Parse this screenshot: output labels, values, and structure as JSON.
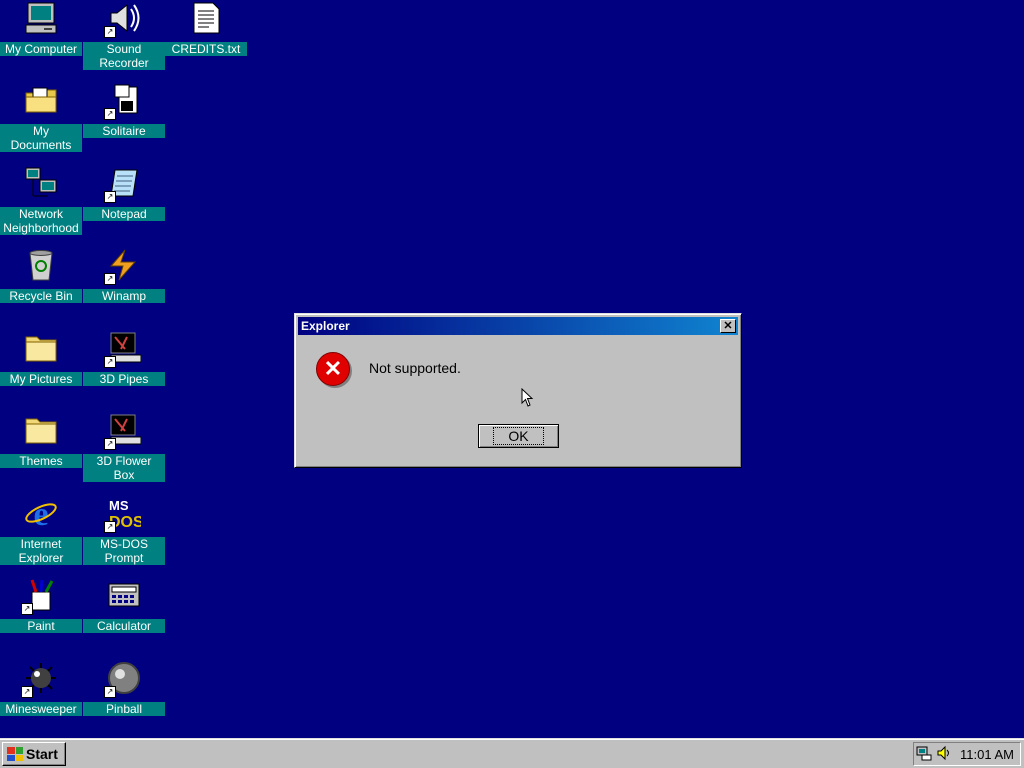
{
  "desktop": {
    "icons": [
      {
        "label": "My Computer",
        "icon": "computer-icon"
      },
      {
        "label": "Sound\nRecorder",
        "icon": "sound-recorder-icon"
      },
      {
        "label": "CREDITS.txt",
        "icon": "text-file-icon"
      },
      {
        "label": "My Documents",
        "icon": "my-documents-icon"
      },
      {
        "label": "Solitaire",
        "icon": "solitaire-icon"
      },
      {
        "label": "Network\nNeighborhood",
        "icon": "network-icon"
      },
      {
        "label": "Notepad",
        "icon": "notepad-icon"
      },
      {
        "label": "Recycle Bin",
        "icon": "recycle-bin-icon"
      },
      {
        "label": "Winamp",
        "icon": "winamp-icon"
      },
      {
        "label": "My Pictures",
        "icon": "folder-icon"
      },
      {
        "label": "3D Pipes",
        "icon": "screensaver-icon"
      },
      {
        "label": "Themes",
        "icon": "folder-icon"
      },
      {
        "label": "3D Flower Box",
        "icon": "screensaver-icon"
      },
      {
        "label": "Internet\nExplorer",
        "icon": "internet-explorer-icon"
      },
      {
        "label": "MS-DOS\nPrompt",
        "icon": "ms-dos-icon"
      },
      {
        "label": "Paint",
        "icon": "paint-icon"
      },
      {
        "label": "Calculator",
        "icon": "calculator-icon"
      },
      {
        "label": "Minesweeper",
        "icon": "minesweeper-icon"
      },
      {
        "label": "Pinball",
        "icon": "pinball-icon"
      }
    ]
  },
  "dialog": {
    "title": "Explorer",
    "message": "Not supported.",
    "ok_label": "OK",
    "close_glyph": "✕"
  },
  "taskbar": {
    "start_label": "Start",
    "clock": "11:01 AM"
  },
  "colors": {
    "desktop": "#000080",
    "label_bg": "#008080",
    "window": "#c0c0c0"
  }
}
